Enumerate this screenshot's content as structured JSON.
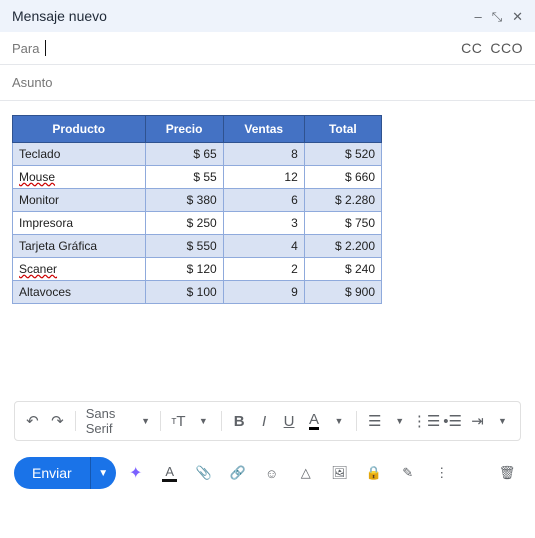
{
  "header": {
    "title": "Mensaje nuevo"
  },
  "fields": {
    "to_label": "Para",
    "cc_label": "CC",
    "cco_label": "CCO",
    "subject_label": "Asunto"
  },
  "table": {
    "headers": [
      "Producto",
      "Precio",
      "Ventas",
      "Total"
    ],
    "rows": [
      {
        "name": "Teclado",
        "price": "$ 65",
        "sales": "8",
        "total": "$ 520",
        "band": true,
        "misspelled": false
      },
      {
        "name": "Mouse",
        "price": "$ 55",
        "sales": "12",
        "total": "$ 660",
        "band": false,
        "misspelled": true
      },
      {
        "name": "Monitor",
        "price": "$ 380",
        "sales": "6",
        "total": "$ 2.280",
        "band": true,
        "misspelled": false
      },
      {
        "name": "Impresora",
        "price": "$ 250",
        "sales": "3",
        "total": "$ 750",
        "band": false,
        "misspelled": false
      },
      {
        "name": "Tarjeta Gráfica",
        "price": "$ 550",
        "sales": "4",
        "total": "$ 2.200",
        "band": true,
        "misspelled": false
      },
      {
        "name": "Scaner",
        "price": "$ 120",
        "sales": "2",
        "total": "$ 240",
        "band": false,
        "misspelled": true
      },
      {
        "name": "Altavoces",
        "price": "$ 100",
        "sales": "9",
        "total": "$ 900",
        "band": true,
        "misspelled": false
      }
    ]
  },
  "format_toolbar": {
    "font_name": "Sans Serif"
  },
  "actions": {
    "send_label": "Enviar"
  }
}
